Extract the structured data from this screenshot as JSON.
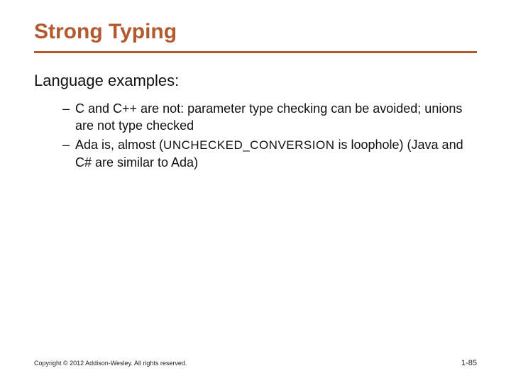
{
  "title": "Strong Typing",
  "subhead": "Language examples:",
  "bullets": [
    {
      "pre": "C and C++ are not: parameter type checking can be avoided; unions are not type checked",
      "sc": "",
      "post": ""
    },
    {
      "pre": "Ada is, almost (",
      "sc": "UNCHECKED_CONVERSION",
      "post": " is loophole) (Java and C# are similar to Ada)"
    }
  ],
  "footer": {
    "copyright": "Copyright © 2012 Addison-Wesley. All rights reserved.",
    "pagenum": "1-85"
  }
}
